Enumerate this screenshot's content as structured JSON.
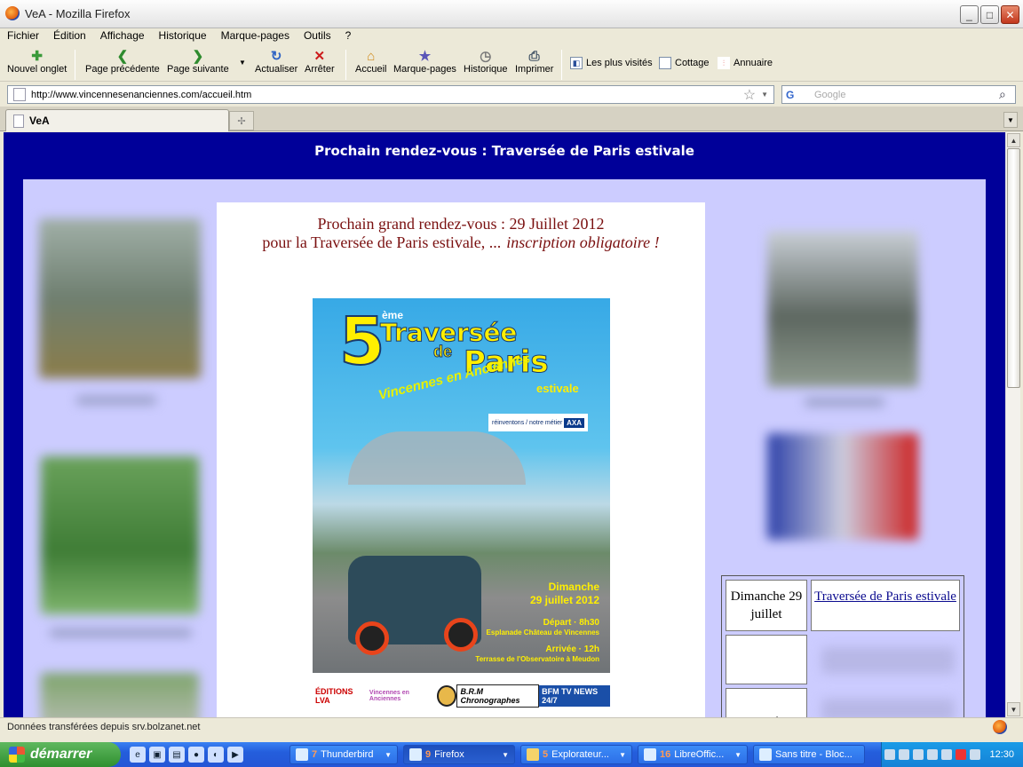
{
  "window": {
    "title": "VeA - Mozilla Firefox",
    "buttons": {
      "minimize": "_",
      "maximize": "□",
      "close": "✕"
    }
  },
  "menu": [
    "Fichier",
    "Édition",
    "Affichage",
    "Historique",
    "Marque-pages",
    "Outils",
    "?"
  ],
  "toolbar": {
    "new_tab": "Nouvel onglet",
    "back": "Page précédente",
    "forward": "Page suivante",
    "reload": "Actualiser",
    "stop": "Arrêter",
    "home": "Accueil",
    "bookmarks": "Marque-pages",
    "history": "Historique",
    "print": "Imprimer"
  },
  "bookmarks_bar": [
    "Les plus visités",
    "Cottage",
    "Annuaire"
  ],
  "address": {
    "url": "http://www.vincennesenanciennes.com/accueil.htm",
    "search_placeholder": "Google"
  },
  "tab": {
    "label": "VeA"
  },
  "page": {
    "banner": "Prochain rendez-vous : Traversée de Paris estivale",
    "headline_line1": "Prochain grand rendez-vous : 29 Juillet 2012",
    "headline_line2": "pour la Traversée de Paris estivale, ...",
    "headline_note": "inscription obligatoire !",
    "poster": {
      "number": "5",
      "ordinal": "ème",
      "title": "Traversée",
      "de": "de",
      "paris": "Paris",
      "estivale": "estivale",
      "club": "Vincennes en Anciennes",
      "sponsor_text": "réinventons / notre métier",
      "sponsor_logo": "AXA",
      "day": "Dimanche",
      "date": "29 juillet 2012",
      "depart": "Départ · 8h30",
      "depart_place": "Esplanade Château de Vincennes",
      "arrivee": "Arrivée · 12h",
      "arrivee_place": "Terrasse de l'Observatoire à Meudon"
    },
    "logos": [
      "ÉDITIONS LVA",
      "Vincennes en Anciennes",
      "",
      "B.R.M Chronographes",
      "BFM TV NEWS 24/7"
    ],
    "schedule": {
      "date": "Dimanche 29 juillet",
      "event": "Traversée de Paris estivale",
      "row3_date": "septembre"
    }
  },
  "status": {
    "text": "Données transférées depuis srv.bolzanet.net"
  },
  "taskbar": {
    "start": "démarrer",
    "items": [
      {
        "count": "7",
        "label": "Thunderbird"
      },
      {
        "count": "9",
        "label": "Firefox"
      },
      {
        "count": "5",
        "label": "Explorateur..."
      },
      {
        "count": "16",
        "label": "LibreOffic..."
      },
      {
        "count": "",
        "label": "Sans titre - Bloc..."
      }
    ],
    "clock": "12:30"
  }
}
